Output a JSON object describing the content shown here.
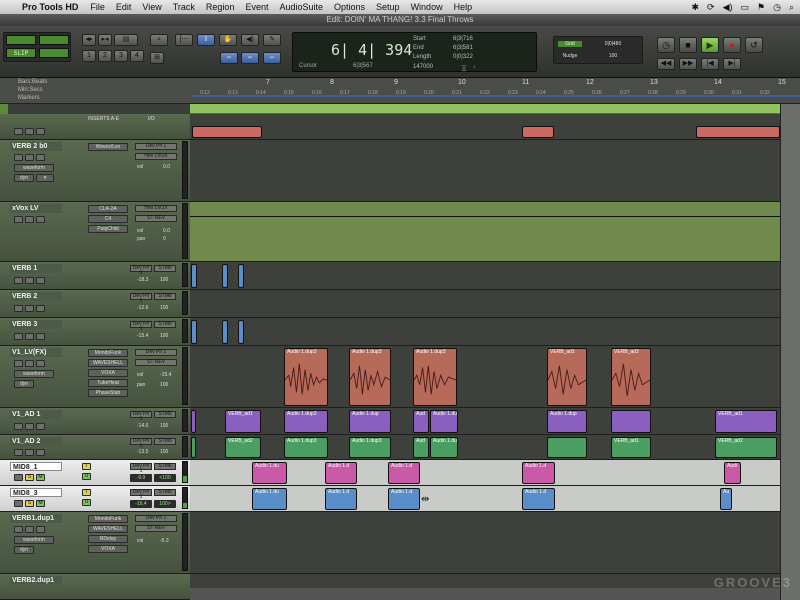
{
  "menubar": {
    "app": "Pro Tools HD",
    "items": [
      "File",
      "Edit",
      "View",
      "Track",
      "Region",
      "Event",
      "AudioSuite",
      "Options",
      "Setup",
      "Window",
      "Help"
    ]
  },
  "window": {
    "title": "Edit: DOIN' MA THANG! 3.3 Final Throws"
  },
  "transport": {
    "main_counter": "6| 4| 394",
    "cursor_label": "Cursor",
    "cursor_value": "6|3|567",
    "start_label": "Start",
    "start_value": "6|3|716",
    "end_label": "End",
    "end_value": "6|3|581",
    "length_label": "Length",
    "length_value": "0|0|322",
    "tempo": "147000",
    "nudge_label": "Nudge",
    "grid_label": "Grid",
    "grid_value": "0|0|480",
    "nudge_value": "100",
    "slip_label": "SLIP"
  },
  "ruler": {
    "rows": [
      "Bars:Beats",
      "Min:Secs",
      "Markers"
    ],
    "bars": [
      "7",
      "8",
      "9",
      "10",
      "11",
      "12",
      "13",
      "14",
      "15"
    ],
    "ticks": [
      "0:12",
      "0:13",
      "0:14",
      "0:15",
      "0:16",
      "0:17",
      "0:18",
      "0:19",
      "0:20",
      "0:21",
      "0:22",
      "0:23",
      "0:24",
      "0:25",
      "0:26",
      "0:27",
      "0:28",
      "0:29",
      "0:30",
      "0:31",
      "0:32"
    ]
  },
  "inserts_header": "INSERTS A-E",
  "io_header": "I/O",
  "tracks": [
    {
      "name": "VERB 2 b0",
      "plugin": "Waves/Lex",
      "io": "Dev Pri 1",
      "io2": "Hex LVOX",
      "vol": "vol",
      "volv": "0.0"
    },
    {
      "name": "xVox LV",
      "plugin": "CLA-2A",
      "plugin2": "C4",
      "plugin3": "PuigChild",
      "io": "Hex LVOX",
      "io2": "ST REV",
      "vol": "vol",
      "volv": "0.0",
      "pan": "pan",
      "panv": "0"
    },
    {
      "name": "VERB 1",
      "io": "Dev Pri 1",
      "io2": "STM6",
      "vol": "-18.3",
      "volv": "100"
    },
    {
      "name": "VERB 2",
      "io": "Dev Pri 1",
      "io2": "STM6",
      "vol": "-12.6",
      "volv": "100"
    },
    {
      "name": "VERB 3",
      "io": "Dev Pri 1",
      "io2": "STM6",
      "vol": "-15.4",
      "volv": "100"
    },
    {
      "name": "V1_LV(FX)",
      "plugin": "MondoFunk",
      "plugin2": "WAVESHELL",
      "plugin3": "VOXA",
      "plugin4": "TubeHeat",
      "plugin5": "PhaseStab",
      "io": "Dev Pri 1",
      "io2": "ST REV",
      "vol": "vol",
      "volv": "-15.4",
      "pan": "pan",
      "panv": "100"
    },
    {
      "name": "V1_AD 1",
      "io": "Dev Pri 1",
      "io2": "STM6",
      "vol": "-14.6",
      "volv": "100"
    },
    {
      "name": "V1_AD 2",
      "io": "Dev Pri 1",
      "io2": "STM6",
      "vol": "-13.5",
      "volv": "100"
    },
    {
      "name": "MID8_1",
      "io": "Dev Pri 1",
      "io2": "STM6",
      "vol": "-9.9",
      "volv": "<100"
    },
    {
      "name": "MID8_3",
      "io": "Dev Pri 1",
      "io2": "STM6",
      "vol": "-16.4",
      "volv": "100>"
    },
    {
      "name": "VERB1.dup1",
      "plugin": "MondoFunk",
      "plugin2": "WAVESHELL",
      "plugin3": "RDelay",
      "plugin4": "VOXA",
      "io": "Dev Pri 1",
      "io2": "ST REV",
      "vol": "vol",
      "volv": "-5.3"
    },
    {
      "name": "VERB2.dup1"
    }
  ],
  "clips": {
    "v1lv": [
      "Audio 1.dup3",
      "Audio 1.dup3",
      "Audio 1.dup3",
      "VERB_ad1",
      "VERB_ad2"
    ],
    "ad1": [
      "VERB_ad1",
      "Audio 1.dup3",
      "Audio 1.dup",
      "Aud",
      "Audio 1.dup",
      "Audio 1.dup",
      "VERB_ad1"
    ],
    "ad2": [
      "VERB_ad2",
      "Audio 1.dup3",
      "Audio 1.dup3",
      "Aud",
      "Audio 1.dup",
      "VERB_ad1",
      "VERB_ad2"
    ],
    "mid1": [
      "Audio 1.du",
      "Audio 1.d",
      "Audio 1.d",
      "Audio 1.d",
      "Audi"
    ],
    "mid3": [
      "Audio 1.du",
      "Audio 1.d",
      "Audio 1.d",
      "Audio 1.d",
      "Au"
    ]
  },
  "watermark": "GROOVE3",
  "colors": {
    "v1lv": "#b86a5a",
    "ad1": "#8b5fc0",
    "ad2": "#4a9e62",
    "mid1": "#c85aa8",
    "mid3": "#5a8ec8",
    "verb": "#c86a62"
  }
}
